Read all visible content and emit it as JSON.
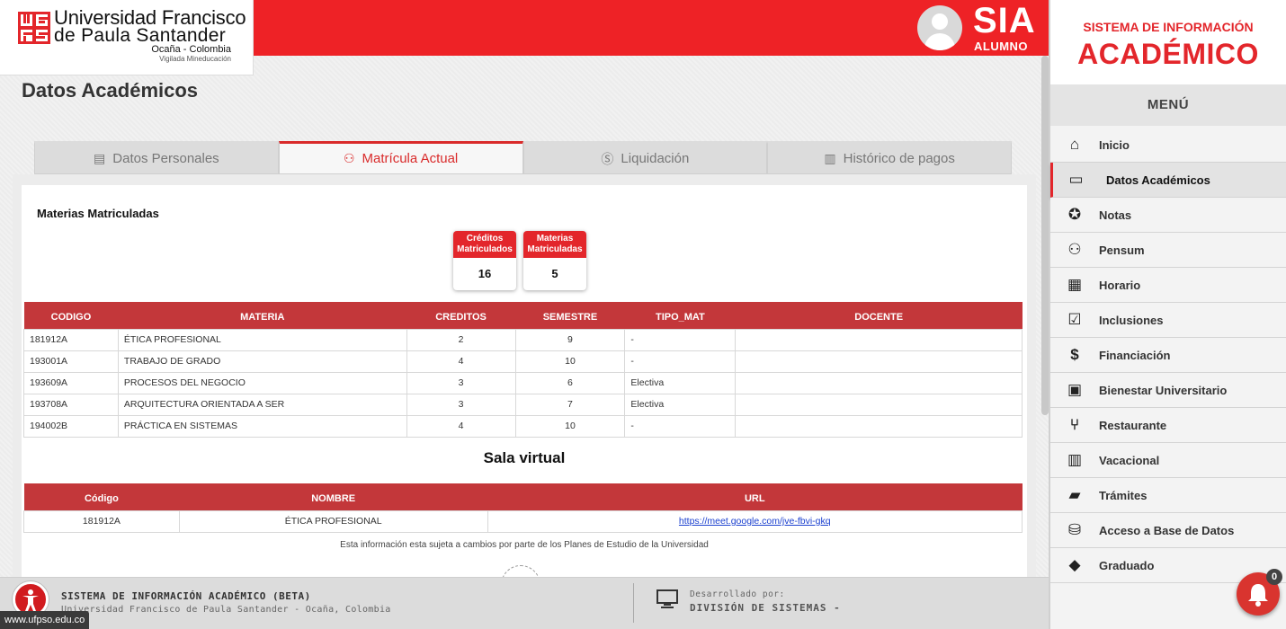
{
  "university": {
    "name_line1": "Universidad Francisco",
    "name_line2": "de Paula Santander",
    "location": "Ocaña - Colombia",
    "vigilada": "Vigilada Mineducación"
  },
  "header": {
    "app": "SIA",
    "role": "ALUMNO"
  },
  "page": {
    "title": "Datos Académicos"
  },
  "tabs": [
    {
      "label": "Datos Personales",
      "icon": "id-card-icon",
      "active": false
    },
    {
      "label": "Matrícula Actual",
      "icon": "sitemap-icon",
      "active": true
    },
    {
      "label": "Liquidación",
      "icon": "dollar-circle-icon",
      "active": false
    },
    {
      "label": "Histórico de pagos",
      "icon": "bar-chart-icon",
      "active": false
    }
  ],
  "enrolled": {
    "title": "Materias Matriculadas",
    "stats": [
      {
        "label": "Créditos Matriculados",
        "value": "16"
      },
      {
        "label": "Materias Matriculadas",
        "value": "5"
      }
    ],
    "columns": [
      "CODIGO",
      "MATERIA",
      "CREDITOS",
      "SEMESTRE",
      "TIPO_MAT",
      "DOCENTE"
    ],
    "rows": [
      {
        "codigo": "181912A",
        "materia": "ÉTICA PROFESIONAL",
        "creditos": "2",
        "semestre": "9",
        "tipo": "-",
        "docente": ""
      },
      {
        "codigo": "193001A",
        "materia": "TRABAJO DE GRADO",
        "creditos": "4",
        "semestre": "10",
        "tipo": "-",
        "docente": ""
      },
      {
        "codigo": "193609A",
        "materia": "PROCESOS DEL NEGOCIO",
        "creditos": "3",
        "semestre": "6",
        "tipo": "Electiva",
        "docente": ""
      },
      {
        "codigo": "193708A",
        "materia": "ARQUITECTURA ORIENTADA A SER",
        "creditos": "3",
        "semestre": "7",
        "tipo": "Electiva",
        "docente": ""
      },
      {
        "codigo": "194002B",
        "materia": "PRÁCTICA EN SISTEMAS",
        "creditos": "4",
        "semestre": "10",
        "tipo": "-",
        "docente": ""
      }
    ]
  },
  "virtual": {
    "title": "Sala virtual",
    "columns": [
      "Código",
      "NOMBRE",
      "URL"
    ],
    "rows": [
      {
        "codigo": "181912A",
        "nombre": "ÉTICA PROFESIONAL",
        "url": "https://meet.google.com/jve-fbvi-gkq"
      }
    ]
  },
  "disclaimer": "Esta información esta sujeta a cambios por parte de los Planes de Estudio de la Universidad",
  "footer": {
    "title": "SISTEMA DE INFORMACIÓN ACADÉMICO (BETA)",
    "subtitle": "Universidad Francisco de Paula Santander - Ocaña, Colombia",
    "dev_label": "Desarrollado por:",
    "dev_name": "DIVISIÓN DE SISTEMAS -"
  },
  "status_url": "www.ufpso.edu.co",
  "sidebar": {
    "brand_top": "SISTEMA DE INFORMACIÓN",
    "brand_main": "ACADÉMICO",
    "menu_title": "MENÚ",
    "items": [
      {
        "label": "Inicio",
        "icon": "home-icon",
        "glyph": "⌂",
        "active": false
      },
      {
        "label": "Datos Académicos",
        "icon": "card-icon",
        "glyph": "▭",
        "active": true
      },
      {
        "label": "Notas",
        "icon": "medal-icon",
        "glyph": "✪",
        "active": false
      },
      {
        "label": "Pensum",
        "icon": "sitemap-icon",
        "glyph": "⚇",
        "active": false
      },
      {
        "label": "Horario",
        "icon": "calendar-icon",
        "glyph": "▦",
        "active": false
      },
      {
        "label": "Inclusiones",
        "icon": "checkbox-icon",
        "glyph": "☑",
        "active": false
      },
      {
        "label": "Financiación",
        "icon": "dollar-circle-icon",
        "glyph": "$",
        "active": false
      },
      {
        "label": "Bienestar Universitario",
        "icon": "briefcase-icon",
        "glyph": "▣",
        "active": false
      },
      {
        "label": "Restaurante",
        "icon": "utensils-icon",
        "glyph": "⑂",
        "active": false
      },
      {
        "label": "Vacacional",
        "icon": "books-icon",
        "glyph": "▥",
        "active": false
      },
      {
        "label": "Trámites",
        "icon": "folder-open-icon",
        "glyph": "▰",
        "active": false
      },
      {
        "label": "Acceso a Base de Datos",
        "icon": "database-icon",
        "glyph": "⛁",
        "active": false
      },
      {
        "label": "Graduado",
        "icon": "graduation-cap-icon",
        "glyph": "◆",
        "active": false
      }
    ]
  },
  "notifications": {
    "count": "0"
  },
  "colors": {
    "brand_red": "#ee2226",
    "table_header": "#c3373a"
  }
}
